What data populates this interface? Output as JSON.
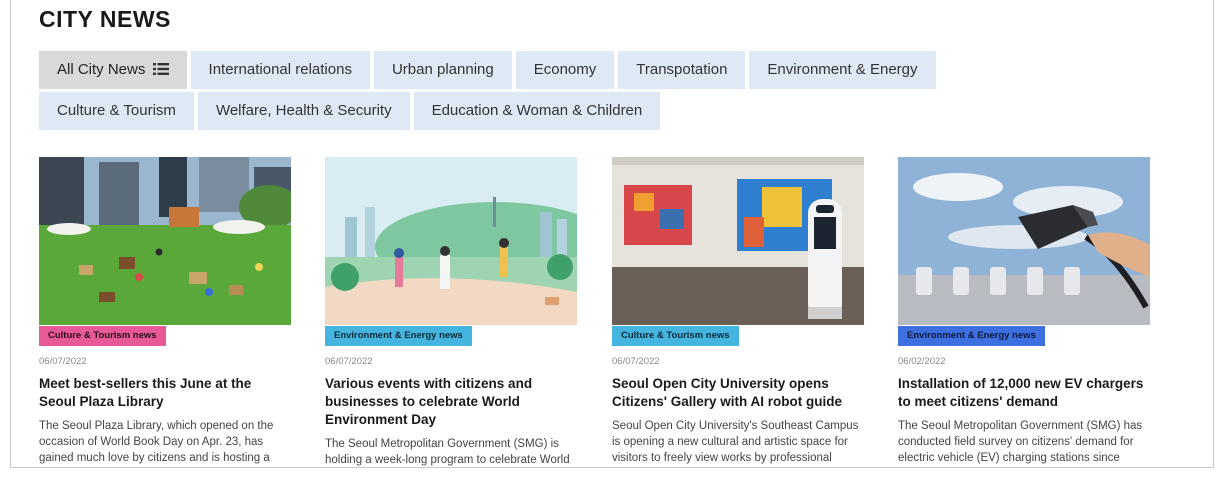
{
  "page": {
    "title": "CITY NEWS"
  },
  "tabs": {
    "row1": [
      {
        "label": "All City News",
        "active": true
      },
      {
        "label": "International relations"
      },
      {
        "label": "Urban planning"
      },
      {
        "label": "Economy"
      },
      {
        "label": "Transpotation"
      },
      {
        "label": "Environment & Energy"
      }
    ],
    "row2": [
      {
        "label": "Culture & Tourism"
      },
      {
        "label": "Welfare, Health & Security"
      },
      {
        "label": "Education & Woman & Children"
      }
    ]
  },
  "colors": {
    "tab_bg": "#dfe8f5",
    "tab_active_bg": "#d9d9d9",
    "badge_culture": "#e85a95",
    "badge_environment": "#45b4df",
    "badge_environment_alt": "#3d6fe0"
  },
  "icons": {
    "all_news_tab": "list-icon"
  },
  "articles": [
    {
      "category": "Culture & Tourism news",
      "date": "06/07/2022",
      "headline": "Meet best-sellers this June at the Seoul Plaza Library",
      "summary": "The Seoul Plaza Library, which opened on the occasion of World Book Day on Apr. 23, has gained much love by citizens and is hosting a month-long book talk program"
    },
    {
      "category": "Environment & Energy news",
      "date": "06/07/2022",
      "headline": "Various events with citizens and businesses to celebrate World Environment Day",
      "summary": "The Seoul Metropolitan Government (SMG) is holding a week-long program to celebrate World Environment Day with"
    },
    {
      "category": "Culture & Tourism news",
      "date": "06/07/2022",
      "headline": "Seoul Open City University opens Citizens' Gallery with AI robot guide",
      "summary": "Seoul Open City University's Southeast Campus is opening a new cultural and artistic space for visitors to freely view works by professional artists at its Citizens'"
    },
    {
      "category": "Environment & Energy news",
      "date": "06/02/2022",
      "headline": "Installation of 12,000 new EV chargers to meet citizens' demand",
      "summary": "The Seoul Metropolitan Government (SMG) has conducted field survey on citizens' demand for electric vehicle (EV) charging stations since February, and will begin full-"
    }
  ]
}
